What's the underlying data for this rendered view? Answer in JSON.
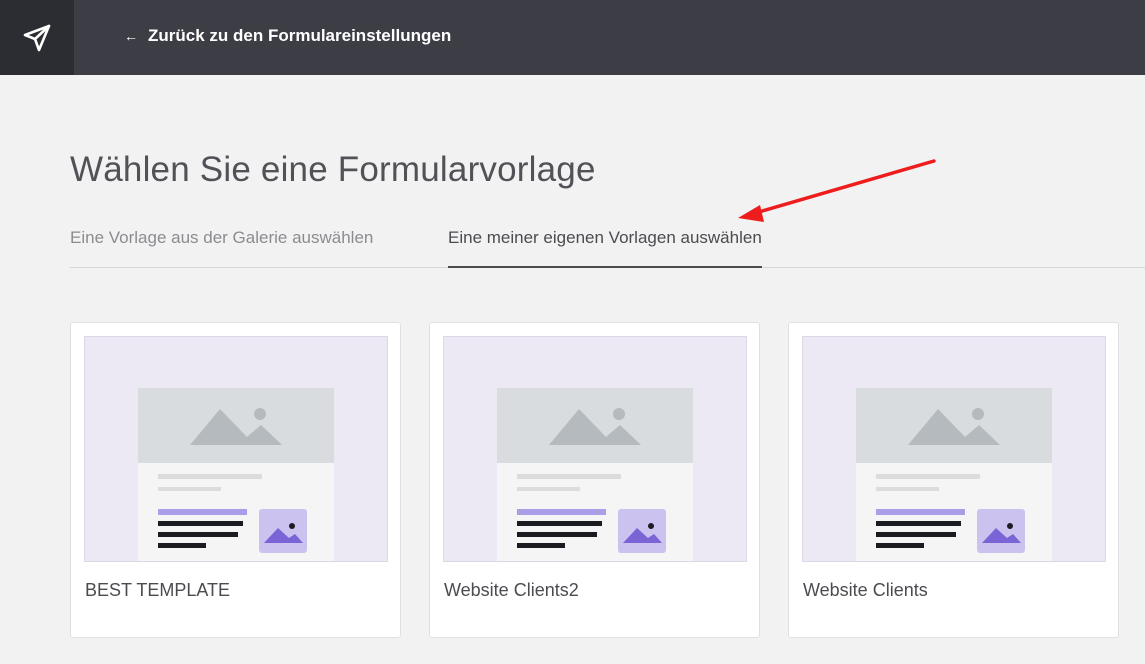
{
  "topbar": {
    "back_link": "Zurück zu den Formulareinstellungen",
    "back_arrow": "←",
    "logo_icon": "paper-plane-icon"
  },
  "page": {
    "title": "Wählen Sie eine Formularvorlage"
  },
  "tabs": [
    {
      "label": "Eine Vorlage aus der Galerie auswählen",
      "active": false
    },
    {
      "label": "Eine meiner eigenen Vorlagen auswählen",
      "active": true
    }
  ],
  "templates": [
    {
      "name": "BEST TEMPLATE"
    },
    {
      "name": "Website Clients2"
    },
    {
      "name": "Website Clients"
    }
  ],
  "colors": {
    "topbar": "#3c3d45",
    "logo_bg": "#2c2d33",
    "thumb_bg": "#ece9f5",
    "accent_purple": "#a99ee8",
    "annotation_arrow": "#ee1c1c"
  }
}
